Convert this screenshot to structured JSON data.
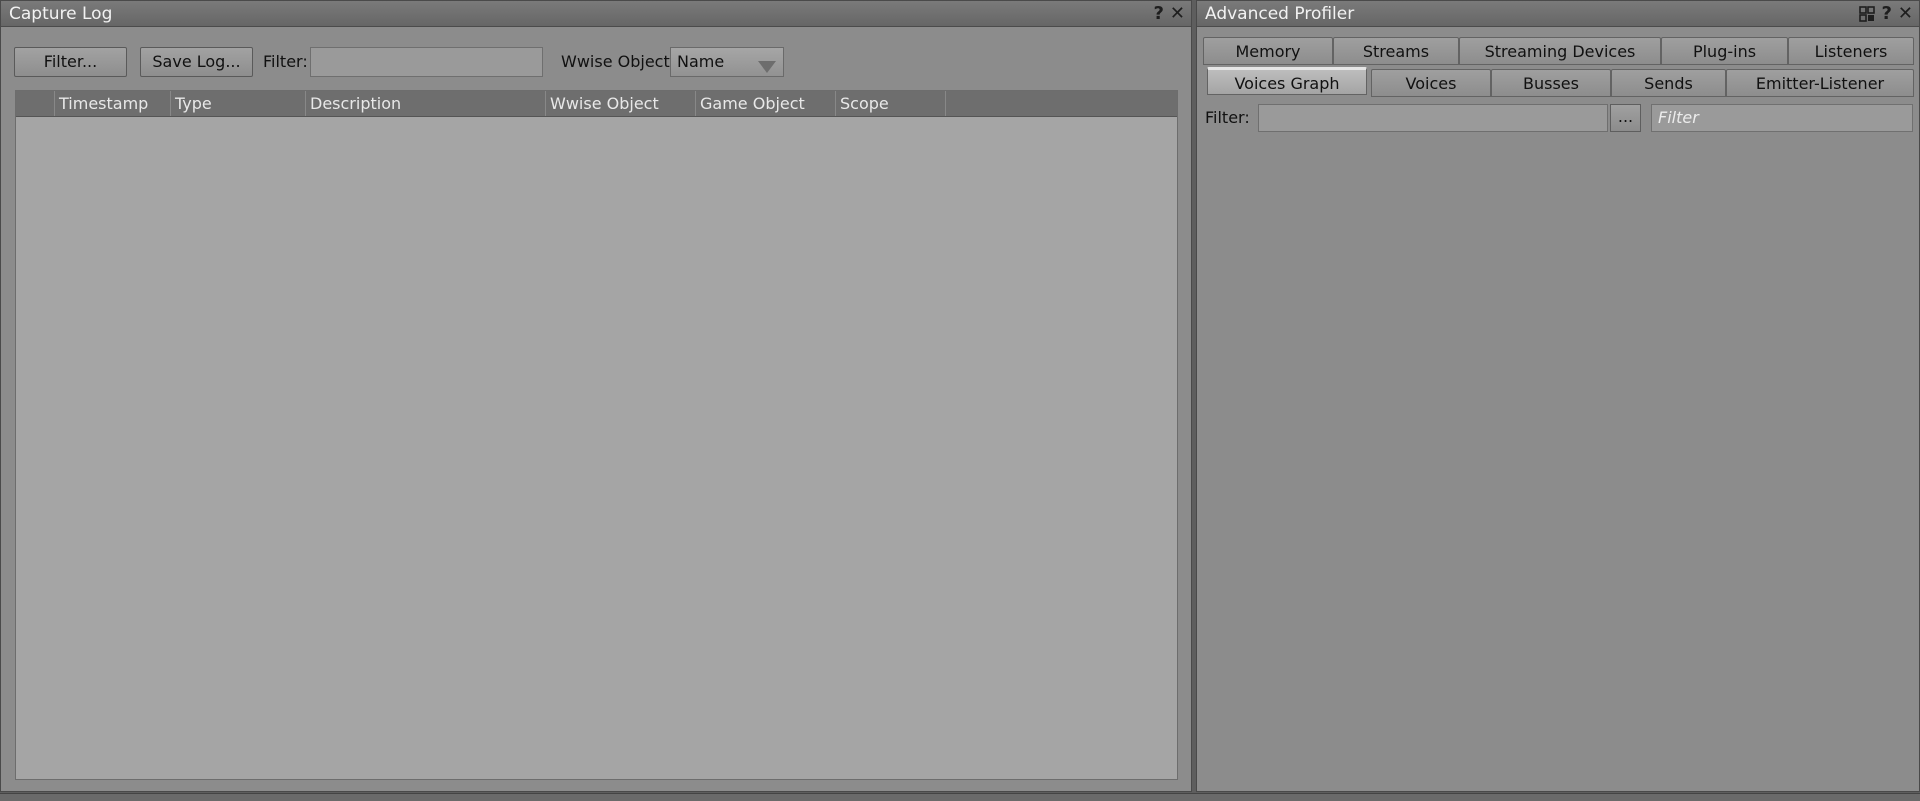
{
  "capture_log": {
    "title": "Capture Log",
    "help_icon": "?",
    "close_icon": "✕",
    "filter_button": "Filter...",
    "save_button": "Save Log...",
    "filter_label": "Filter:",
    "filter_value": "",
    "wwise_object_label": "Wwise Object:",
    "wwise_object_selected": "Name",
    "columns": [
      "",
      "Timestamp",
      "Type",
      "Description",
      "Wwise Object",
      "Game Object",
      "Scope",
      ""
    ]
  },
  "advanced_profiler": {
    "title": "Advanced Profiler",
    "help_icon": "?",
    "close_icon": "✕",
    "tabs_row1": [
      "Memory",
      "Streams",
      "Streaming Devices",
      "Plug-ins",
      "Listeners"
    ],
    "tabs_row2": [
      "Voices Graph",
      "Voices",
      "Busses",
      "Sends",
      "Emitter-Listener"
    ],
    "active_tab": "Voices Graph",
    "filter_label": "Filter:",
    "filter_value": "",
    "browse_button": "...",
    "search_placeholder": "Filter"
  }
}
